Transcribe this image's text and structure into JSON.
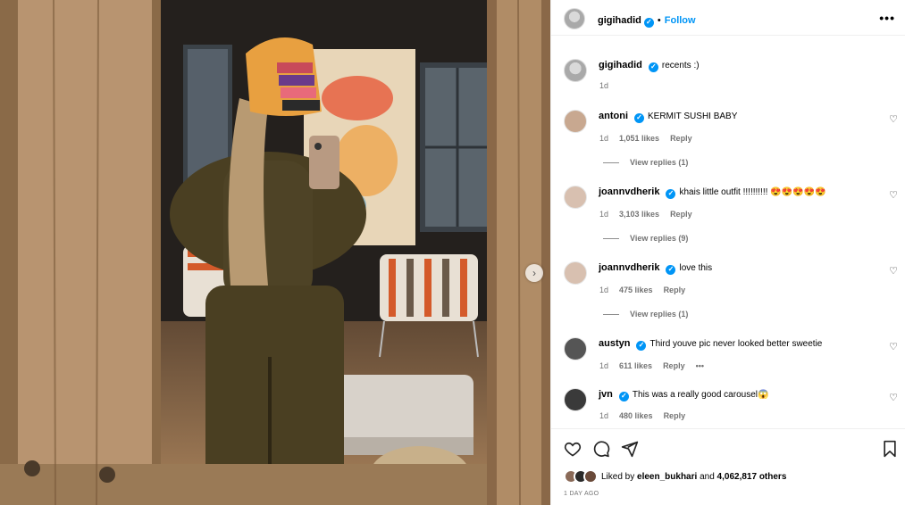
{
  "post": {
    "author": "gigihadid",
    "follow_label": "Follow",
    "dot": "•",
    "more_label": "•••",
    "caption": "recents :)",
    "caption_time": "1d",
    "liked_prefix": "Liked by",
    "liked_user": "eleen_bukhari",
    "liked_and": "and",
    "liked_count": "4,062,817 others",
    "timestamp": "1 DAY AGO"
  },
  "comments": [
    {
      "user": "antoni",
      "text": "KERMIT SUSHI BABY",
      "time": "1d",
      "likes": "1,051 likes",
      "reply": "Reply",
      "view_replies": "View replies (1)"
    },
    {
      "user": "joannvdherik",
      "text": "khais little outfit !!!!!!!!!! 😍😍😍😍😍",
      "time": "1d",
      "likes": "3,103 likes",
      "reply": "Reply",
      "view_replies": "View replies (9)"
    },
    {
      "user": "joannvdherik",
      "text": "love this",
      "time": "1d",
      "likes": "475 likes",
      "reply": "Reply",
      "view_replies": "View replies (1)"
    },
    {
      "user": "austyn",
      "text": "Third youve pic never looked better sweetie",
      "time": "1d",
      "likes": "611 likes",
      "reply": "Reply",
      "options": "•••"
    },
    {
      "user": "jvn",
      "text": "This was a really good carousel😱",
      "time": "1d",
      "likes": "480 likes",
      "reply": "Reply"
    }
  ],
  "icons": {
    "verified": "✓",
    "heart": "♡",
    "next": "›"
  },
  "colors": {
    "accent": "#0095f6",
    "secondary_text": "#737373"
  }
}
